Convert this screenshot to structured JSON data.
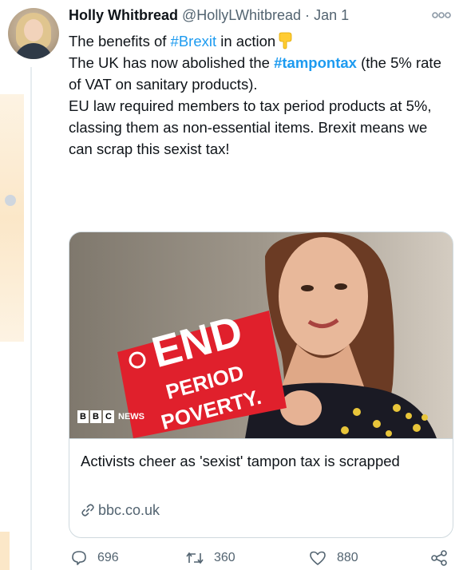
{
  "tweet": {
    "author_name": "Holly Whitbread",
    "handle": "@HollyLWhitbread",
    "separator": "·",
    "date": "Jan 1",
    "text": {
      "line1_prefix": "The benefits of ",
      "line1_hashtag": "#Brexit",
      "line1_suffix": " in action",
      "para2_prefix": "The UK has now abolished the ",
      "para2_hashtag": "#tampontax",
      "para2_suffix": " (the 5% rate of VAT on sanitary products).",
      "para3": "EU law required members to tax period products at 5%, classing them as non-essential items. Brexit means we can scrap this sexist tax!"
    },
    "emoji": "pointing-down-hand"
  },
  "card": {
    "image": {
      "sign_line1": "END",
      "sign_line2": "PERIOD",
      "sign_line3": "POVERTY.",
      "bbc_letters": [
        "B",
        "B",
        "C"
      ],
      "bbc_news": "NEWS"
    },
    "title": "Activists cheer as 'sexist' tampon tax is scrapped",
    "domain": "bbc.co.uk"
  },
  "actions": {
    "replies": "696",
    "retweets": "360",
    "likes": "880"
  },
  "colors": {
    "link_blue": "#1d9bf0",
    "secondary_text": "#536471",
    "sign_red": "#e0202c"
  },
  "icons": {
    "more": "more-dots-icon",
    "reply": "reply-icon",
    "retweet": "retweet-icon",
    "like": "like-icon",
    "share": "share-icon",
    "link": "link-icon"
  }
}
